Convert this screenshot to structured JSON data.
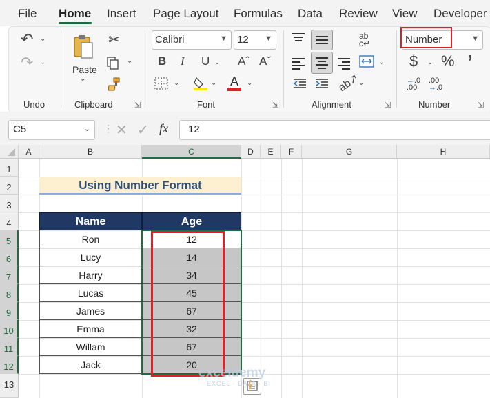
{
  "menu": {
    "items": [
      "File",
      "Home",
      "Insert",
      "Page Layout",
      "Formulas",
      "Data",
      "Review",
      "View",
      "Developer"
    ],
    "active": "Home"
  },
  "ribbon": {
    "undo_label": "Undo",
    "clipboard": {
      "label": "Clipboard",
      "paste_label": "Paste"
    },
    "font": {
      "label": "Font",
      "name": "Calibri",
      "size": "12",
      "bold": "B",
      "italic": "I",
      "underline": "U"
    },
    "alignment": {
      "label": "Alignment"
    },
    "number": {
      "label": "Number",
      "format": "Number",
      "currency": "$",
      "percent": "%",
      "comma": "’",
      "inc_decimal": "←.0 .00",
      "dec_decimal": ".00 →.0"
    }
  },
  "formula_bar": {
    "name_box": "C5",
    "fx": "fx",
    "value": "12"
  },
  "columns": [
    "A",
    "B",
    "C",
    "D",
    "E",
    "F",
    "G",
    "H"
  ],
  "selected_column": "C",
  "rows": [
    "1",
    "2",
    "3",
    "4",
    "5",
    "6",
    "7",
    "8",
    "9",
    "10",
    "11",
    "12",
    "13"
  ],
  "selected_rows": [
    "5",
    "6",
    "7",
    "8",
    "9",
    "10",
    "11",
    "12"
  ],
  "sheet": {
    "title": "Using Number Format",
    "headers": {
      "name": "Name",
      "age": "Age"
    },
    "records": [
      {
        "name": "Ron",
        "age": "12"
      },
      {
        "name": "Lucy",
        "age": "14"
      },
      {
        "name": "Harry",
        "age": "34"
      },
      {
        "name": "Lucas",
        "age": "45"
      },
      {
        "name": "James",
        "age": "67"
      },
      {
        "name": "Emma",
        "age": "32"
      },
      {
        "name": "Willam",
        "age": "67"
      },
      {
        "name": "Jack",
        "age": "20"
      }
    ]
  },
  "watermark": {
    "brand": "exceldemy",
    "tagline": "EXCEL · DATA · BI"
  },
  "colors": {
    "accent": "#1e6c41",
    "header_fill": "#1f3864",
    "title_fill": "#fdf0d0",
    "selection_fill": "#c6c6c6",
    "highlight_border": "#e21f26"
  }
}
